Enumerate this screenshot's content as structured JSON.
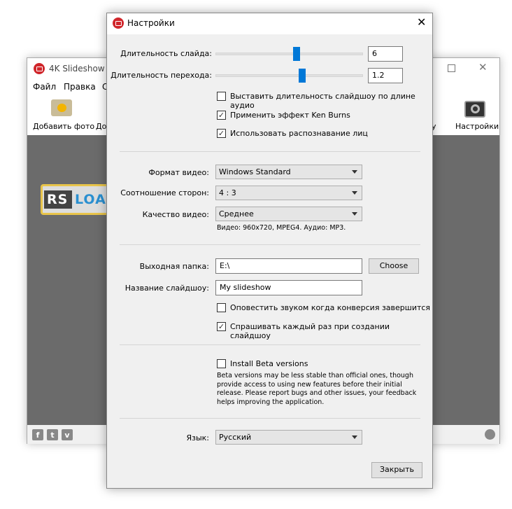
{
  "main_window": {
    "title": "4K Slideshow M",
    "menu": [
      "Файл",
      "Правка",
      "С"
    ],
    "toolbar": {
      "add_photo": "Добавить фото",
      "add_other": "До",
      "partial": "у",
      "settings": "Настройки"
    },
    "logo_text": "RSLOA",
    "social": [
      "f",
      "t",
      "v"
    ]
  },
  "dialog": {
    "title": "Настройки",
    "slide_duration": {
      "label": "Длительность слайда:",
      "value": "6",
      "level": 0.55
    },
    "transition_duration": {
      "label": "Длительность перехода:",
      "value": "1.2",
      "level": 0.59
    },
    "checkboxes1": [
      {
        "label": "Выставить длительность слайдшоу по длине аудио",
        "checked": false
      },
      {
        "label": "Применить эффект Ken Burns",
        "checked": true
      },
      {
        "label": "Использовать распознавание лиц",
        "checked": true
      }
    ],
    "video_format": {
      "label": "Формат видео:",
      "value": "Windows Standard"
    },
    "aspect_ratio": {
      "label": "Соотношение сторон:",
      "value": "4 : 3"
    },
    "video_quality": {
      "label": "Качество видео:",
      "value": "Среднее"
    },
    "video_info": "Видео: 960x720, MPEG4. Аудио: MP3.",
    "output_folder": {
      "label": "Выходная папка:",
      "value": "E:\\",
      "choose": "Choose"
    },
    "slideshow_name": {
      "label": "Название слайдшоу:",
      "value": "My slideshow"
    },
    "checkboxes2": [
      {
        "label": "Оповестить звуком когда конверсия завершится",
        "checked": false
      },
      {
        "label": "Спрашивать каждый раз при создании слайдшоу",
        "checked": true
      }
    ],
    "beta": {
      "label": "Install Beta versions",
      "checked": false,
      "description": "Beta versions may be less stable than official ones, though provide access to using new features before their initial release. Please report bugs and other issues, your feedback helps improving the application."
    },
    "language": {
      "label": "Язык:",
      "value": "Русский"
    },
    "close": "Закрыть"
  }
}
